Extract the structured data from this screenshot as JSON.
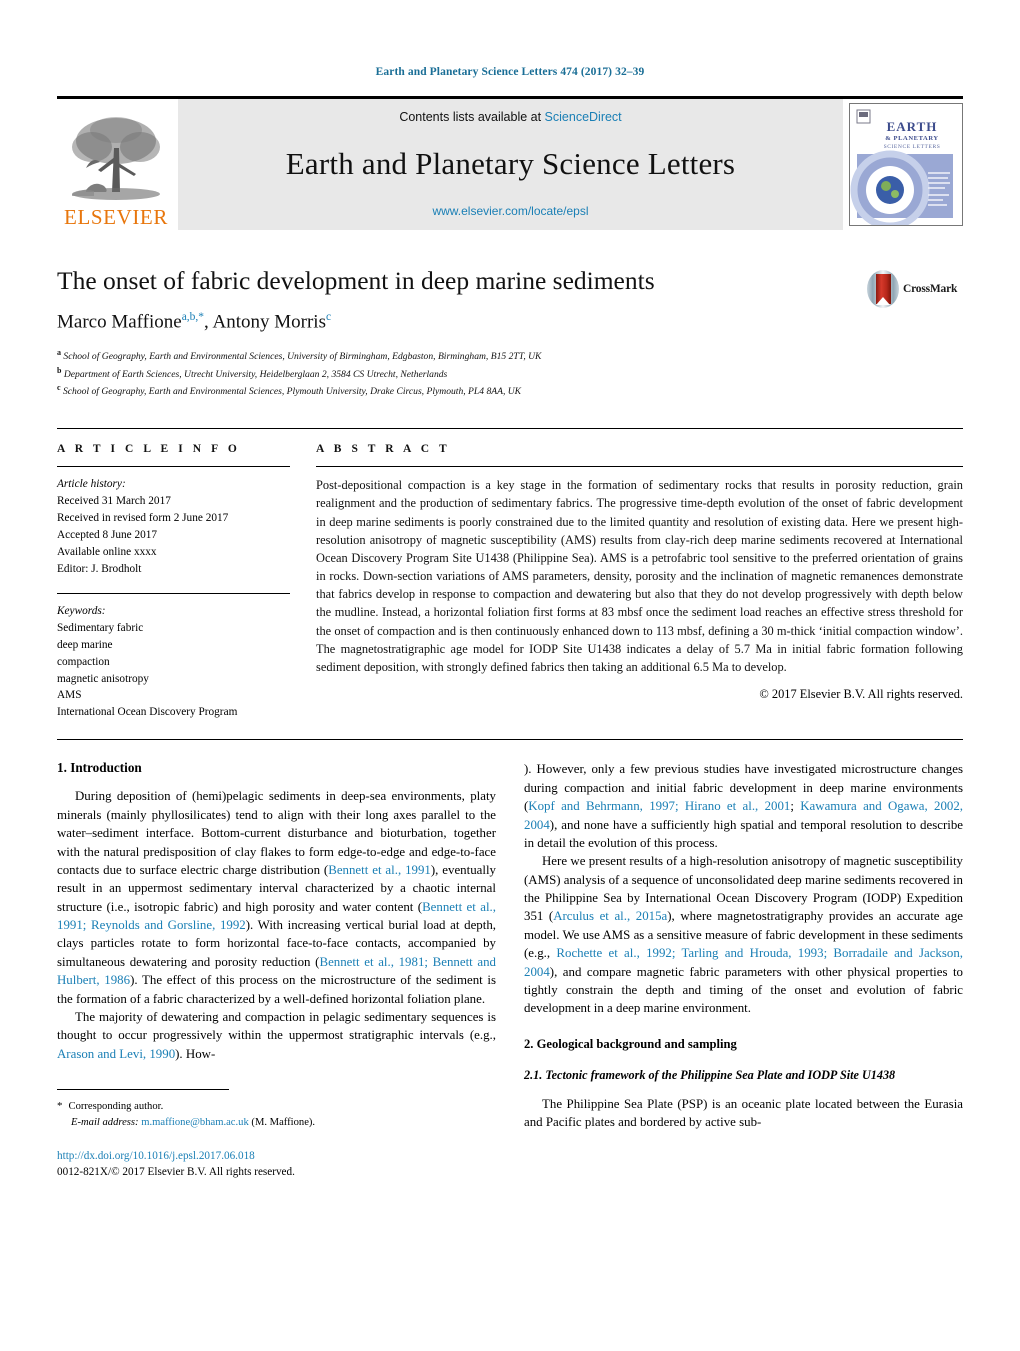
{
  "running_head": "Earth and Planetary Science Letters 474 (2017) 32–39",
  "masthead": {
    "publisher_name": "ELSEVIER",
    "contents_prefix": "Contents lists available at ",
    "contents_link": "ScienceDirect",
    "journal_title": "Earth and Planetary Science Letters",
    "journal_url": "www.elsevier.com/locate/epsl",
    "cover_title_line1": "EARTH",
    "cover_title_line2": "& PLANETARY",
    "cover_title_line3": "SCIENCE LETTERS"
  },
  "article": {
    "title": "The onset of fabric development in deep marine sediments",
    "authors_html": "Marco Maffione<sup>a,b,*</sup>, Antony Morris<sup>c</sup>",
    "affiliations": [
      {
        "mark": "a",
        "text": "School of Geography, Earth and Environmental Sciences, University of Birmingham, Edgbaston, Birmingham, B15 2TT, UK"
      },
      {
        "mark": "b",
        "text": "Department of Earth Sciences, Utrecht University, Heidelberglaan 2, 3584 CS Utrecht, Netherlands"
      },
      {
        "mark": "c",
        "text": "School of Geography, Earth and Environmental Sciences, Plymouth University, Drake Circus, Plymouth, PL4 8AA, UK"
      }
    ],
    "crossmark_label": "CrossMark"
  },
  "article_info": {
    "heading": "A R T I C L E  I N F O",
    "history_title": "Article history:",
    "history": [
      "Received 31 March 2017",
      "Received in revised form 2 June 2017",
      "Accepted 8 June 2017",
      "Available online xxxx",
      "Editor: J. Brodholt"
    ],
    "keywords_title": "Keywords:",
    "keywords": [
      "Sedimentary fabric",
      "deep marine",
      "compaction",
      "magnetic anisotropy",
      "AMS",
      "International Ocean Discovery Program"
    ]
  },
  "abstract": {
    "heading": "A B S T R A C T",
    "text": "Post-depositional compaction is a key stage in the formation of sedimentary rocks that results in porosity reduction, grain realignment and the production of sedimentary fabrics. The progressive time-depth evolution of the onset of fabric development in deep marine sediments is poorly constrained due to the limited quantity and resolution of existing data. Here we present high-resolution anisotropy of magnetic susceptibility (AMS) results from clay-rich deep marine sediments recovered at International Ocean Discovery Program Site U1438 (Philippine Sea). AMS is a petrofabric tool sensitive to the preferred orientation of grains in rocks. Down-section variations of AMS parameters, density, porosity and the inclination of magnetic remanences demonstrate that fabrics develop in response to compaction and dewatering but also that they do not develop progressively with depth below the mudline. Instead, a horizontal foliation first forms at 83 mbsf once the sediment load reaches an effective stress threshold for the onset of compaction and is then continuously enhanced down to 113 mbsf, defining a 30 m-thick ‘initial compaction window’. The magnetostratigraphic age model for IODP Site U1438 indicates a delay of 5.7 Ma in initial fabric formation following sediment deposition, with strongly defined fabrics then taking an additional 6.5 Ma to develop.",
    "copyright": "© 2017 Elsevier B.V. All rights reserved."
  },
  "body": {
    "section1_heading": "1. Introduction",
    "p1_a": "During deposition of (hemi)pelagic sediments in deep-sea environments, platy minerals (mainly phyllosilicates) tend to align with their long axes parallel to the water–sediment interface. Bottom-current disturbance and bioturbation, together with the natural predisposition of clay flakes to form edge-to-edge and edge-to-face contacts due to surface electric charge distribution (",
    "p1_ref1": "Bennett et al., 1991",
    "p1_b": "), eventually result in an uppermost sedimentary interval characterized by a chaotic internal structure (i.e., isotropic fabric) and high porosity and water content (",
    "p1_ref2": "Bennett et al., 1991; Reynolds and Gorsline, 1992",
    "p1_c": "). With increasing vertical burial load at depth, clays particles rotate to form horizontal face-to-face contacts, accompanied by simultaneous dewatering and porosity reduction (",
    "p1_ref3": "Bennett et al., 1981; Bennett and Hulbert, 1986",
    "p1_d": "). The effect of this process on the microstructure of the sediment is the formation of a fabric characterized by a well-defined horizontal foliation plane.",
    "p2_a": "The majority of dewatering and compaction in pelagic sedimentary sequences is thought to occur progressively within the uppermost stratigraphic intervals (e.g., ",
    "p2_ref1": "Arason and Levi, 1990",
    "p2_b": "). However, only a few previous studies have investigated microstructure changes during compaction and initial fabric development in deep marine environments (",
    "p2_ref2": "Kopf and Behrmann, 1997; Hirano et al., 2001",
    "p2_c": "; ",
    "p2_ref3": "Kawamura and Ogawa, 2002, 2004",
    "p2_d": "), and none have a sufficiently high spatial and temporal resolution to describe in detail the evolution of this process.",
    "p3_a": "Here we present results of a high-resolution anisotropy of magnetic susceptibility (AMS) analysis of a sequence of unconsolidated deep marine sediments recovered in the Philippine Sea by International Ocean Discovery Program (IODP) Expedition 351 (",
    "p3_ref1": "Arculus et al., 2015a",
    "p3_b": "), where magnetostratigraphy provides an accurate age model. We use AMS as a sensitive measure of fabric development in these sediments (e.g., ",
    "p3_ref2": "Rochette et al., 1992; Tarling and Hrouda, 1993; Borradaile and Jackson, 2004",
    "p3_c": "), and compare magnetic fabric parameters with other physical properties to tightly constrain the depth and timing of the onset and evolution of fabric development in a deep marine environment.",
    "section2_heading": "2. Geological background and sampling",
    "section21_heading": "2.1. Tectonic framework of the Philippine Sea Plate and IODP Site U1438",
    "p4": "The Philippine Sea Plate (PSP) is an oceanic plate located between the Eurasia and Pacific plates and bordered by active sub-"
  },
  "footnote": {
    "star": "*",
    "corresponding": "Corresponding author.",
    "email_label": "E-mail address:",
    "email": "m.maffione@bham.ac.uk",
    "email_suffix": "(M. Maffione)."
  },
  "footer": {
    "doi": "http://dx.doi.org/10.1016/j.epsl.2017.06.018",
    "issn_copyright": "0012-821X/© 2017 Elsevier B.V. All rights reserved."
  },
  "colors": {
    "link": "#1a7fb5",
    "running_head": "#1a6e96",
    "elsevier_orange": "#e8760c",
    "banner_bg": "#e8e8e8"
  }
}
